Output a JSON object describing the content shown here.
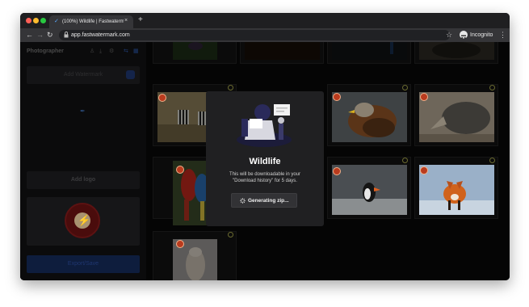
{
  "browser": {
    "tab_title": "(100%) Wildlife | Fastwatermar",
    "tab_close": "×",
    "new_tab": "+",
    "back": "←",
    "forward": "→",
    "reload": "↻",
    "url": "app.fastwatermark.com",
    "star": "☆",
    "profile_label": "Incognito",
    "menu": "⋮",
    "lock": "🔒"
  },
  "sidebar": {
    "title": "Photographer",
    "icons": [
      "person-icon",
      "download-icon",
      "settings-icon",
      "link-icon",
      "grid-icon"
    ],
    "add_text_label": "Add Watermark",
    "add_logo_label": "Add logo",
    "export_label": "Export/Save"
  },
  "gallery": {
    "photos": [
      {
        "subject": "hummingbird"
      },
      {
        "subject": "dark forest"
      },
      {
        "subject": "blue bird"
      },
      {
        "subject": "animal on rock"
      },
      {
        "subject": "zebras"
      },
      {
        "subject": "hidden"
      },
      {
        "subject": "red kite"
      },
      {
        "subject": "rhinoceros"
      },
      {
        "subject": "macaws"
      },
      {
        "subject": "hidden"
      },
      {
        "subject": "puffin"
      },
      {
        "subject": "red fox"
      },
      {
        "subject": "owl"
      }
    ],
    "colors": {
      "badge": "#b93b1e",
      "check": "#6a6a30"
    }
  },
  "modal": {
    "title": "Wildlife",
    "description": "This will be downloadable in your \"Download history\" for 5 days.",
    "button_label": "Generating zip...",
    "button_icon": "spinner-icon"
  }
}
